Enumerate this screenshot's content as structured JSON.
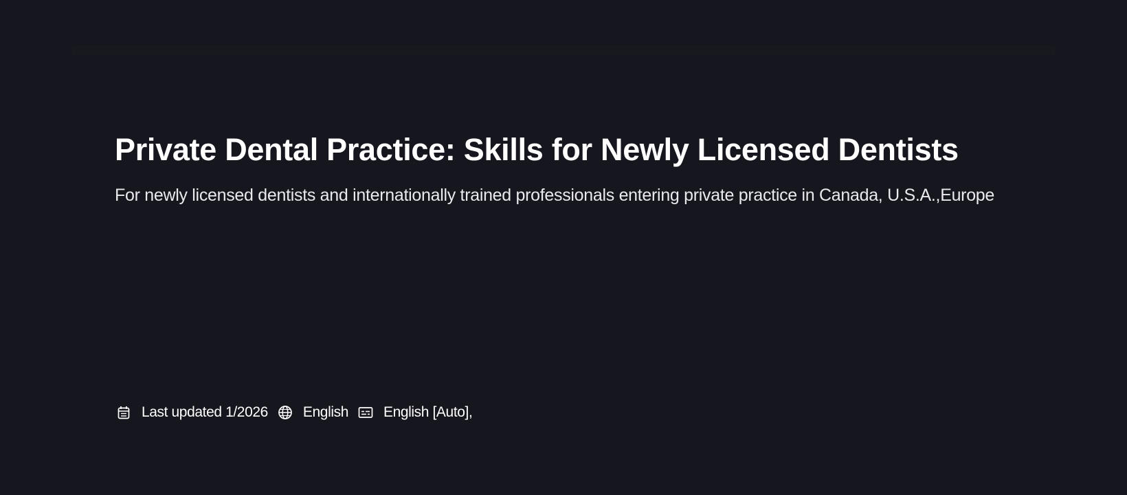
{
  "course": {
    "title": "Private Dental Practice: Skills for Newly Licensed Dentists",
    "subtitle": "For newly licensed dentists and internationally trained professionals entering private practice in Canada, U.S.A.,Europe"
  },
  "meta": {
    "last_updated": "Last updated 1/2026",
    "language": "English",
    "captions": "English [Auto],",
    "icons": {
      "calendar": "calendar-icon",
      "language": "globe-icon",
      "captions": "closed-captions-icon"
    }
  },
  "colors": {
    "background": "#16161f",
    "text": "#ffffff",
    "subtitle_text": "#e9e9ee"
  }
}
